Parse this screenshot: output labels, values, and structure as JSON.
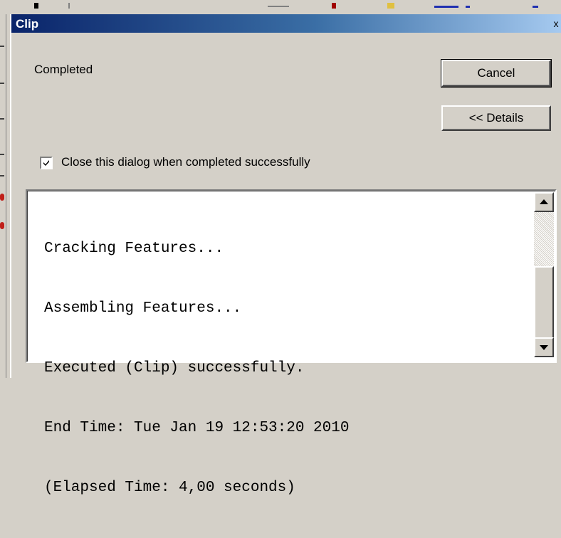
{
  "dialog": {
    "title": "Clip",
    "close_glyph": "x",
    "status": "Completed",
    "cancel_label": "Cancel",
    "details_label": "<< Details",
    "close_on_complete_label": "Close this dialog when completed successfully",
    "close_on_complete_checked": true
  },
  "log": {
    "lines": [
      "Cracking Features...",
      "Assembling Features...",
      "Executed (Clip) successfully.",
      "End Time: Tue Jan 19 12:53:20 2010",
      "(Elapsed Time: 4,00 seconds)"
    ]
  },
  "icons": {
    "checkbox_mark": "check-icon",
    "scroll_up": "arrow-up-icon",
    "scroll_down": "arrow-down-icon",
    "close": "close-icon"
  },
  "colors": {
    "titlebar_start": "#0a246a",
    "titlebar_end": "#a6caf0",
    "dialog_face": "#d4d0c8"
  }
}
